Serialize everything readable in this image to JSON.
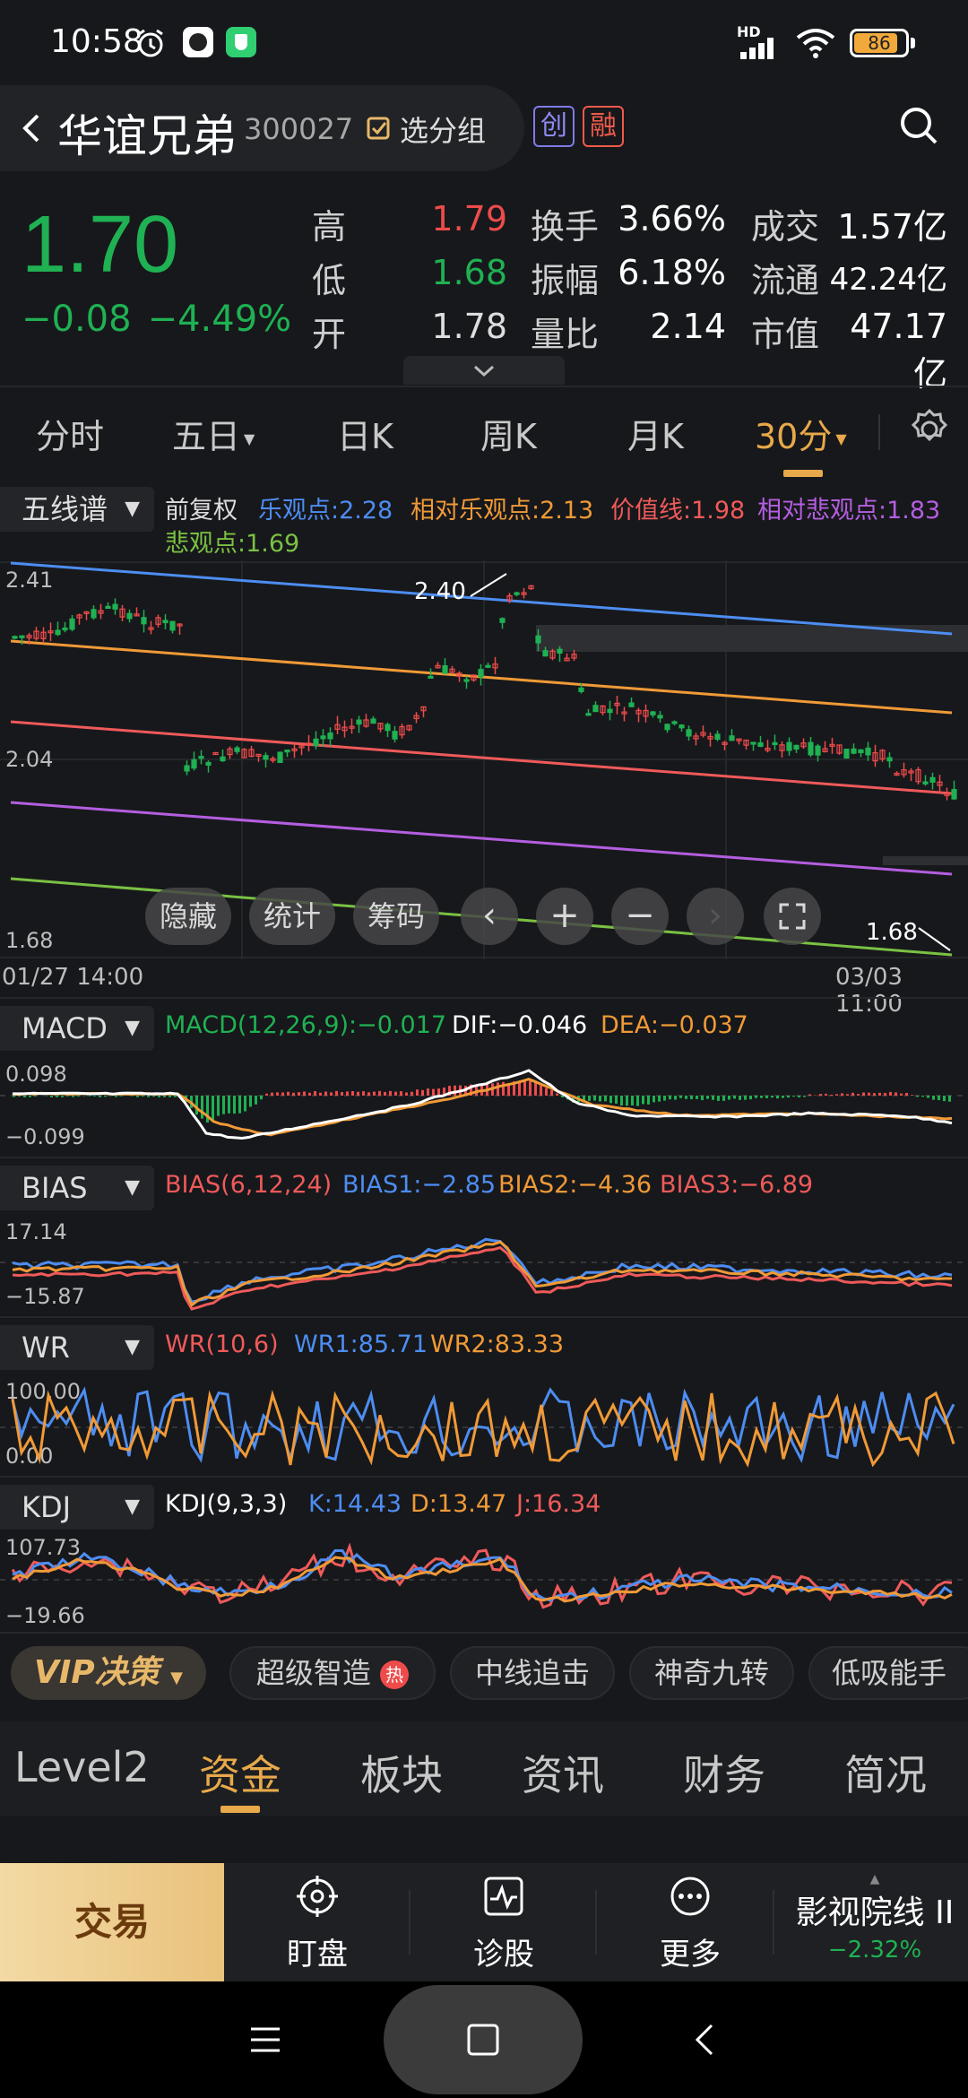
{
  "status_bar": {
    "time": "10:58",
    "network": "HD",
    "battery": "86",
    "icons": [
      "alarm-icon",
      "app-icon",
      "shield-app-icon",
      "signal-icon",
      "wifi-icon",
      "battery-icon"
    ]
  },
  "header": {
    "name": "华谊兄弟",
    "code": "300027",
    "group_label": "选分组",
    "tag_chuang": "创",
    "tag_rong": "融"
  },
  "quote": {
    "price": "1.70",
    "change": "−0.08",
    "change_pct": "−4.49%",
    "high_label": "高",
    "high": "1.79",
    "low_label": "低",
    "low": "1.68",
    "open_label": "开",
    "open": "1.78",
    "turnover_label": "换手",
    "turnover": "3.66%",
    "amplitude_label": "振幅",
    "amplitude": "6.18%",
    "volratio_label": "量比",
    "volratio": "2.14",
    "amount_label": "成交",
    "amount": "1.57亿",
    "float_label": "流通",
    "float": "42.24亿",
    "mcap_label": "市值",
    "mcap": "47.17亿"
  },
  "period_tabs": [
    "分时",
    "五日",
    "日K",
    "周K",
    "月K",
    "30分"
  ],
  "active_period": "30分",
  "main_chart": {
    "indicator": "五线谱",
    "adjust": "前复权",
    "legend": [
      {
        "label": "乐观点:2.28",
        "color": "#4d8df2"
      },
      {
        "label": "相对乐观点:2.13",
        "color": "#f09a37"
      },
      {
        "label": "价值线:1.98",
        "color": "#ef5a5a"
      },
      {
        "label": "相对悲观点:1.83",
        "color": "#b45ee0"
      },
      {
        "label": "悲观点:1.69",
        "color": "#7ac143"
      }
    ],
    "y_top": "2.41",
    "y_mid": "2.04",
    "y_bottom": "1.68",
    "high_marker": "2.40",
    "low_marker": "1.68",
    "time_start": "01/27 14:00",
    "time_end": "03/03 11:00",
    "buttons": [
      "隐藏",
      "统计",
      "筹码"
    ]
  },
  "macd": {
    "name": "MACD",
    "params": "MACD(12,26,9):−0.017",
    "dif": "DIF:−0.046",
    "dea": "DEA:−0.037",
    "y_top": "0.098",
    "y_bottom": "−0.099"
  },
  "bias": {
    "name": "BIAS",
    "params": "BIAS(6,12,24)",
    "b1": "BIAS1:−2.85",
    "b2": "BIAS2:−4.36",
    "b3": "BIAS3:−6.89",
    "y_top": "17.14",
    "y_bottom": "−15.87"
  },
  "wr": {
    "name": "WR",
    "params": "WR(10,6)",
    "w1": "WR1:85.71",
    "w2": "WR2:83.33",
    "y_top": "100.00",
    "y_bottom": "0.00"
  },
  "kdj": {
    "name": "KDJ",
    "params": "KDJ(9,3,3)",
    "k": "K:14.43",
    "d": "D:13.47",
    "j": "J:16.34",
    "y_top": "107.73",
    "y_bottom": "−19.66"
  },
  "strategy": {
    "vip": "VIP决策",
    "chips": [
      "超级智造",
      "中线追击",
      "神奇九转",
      "低吸能手"
    ],
    "hot_badge": "热"
  },
  "bottom_tabs": [
    "Level2",
    "资金",
    "板块",
    "资讯",
    "财务",
    "简况"
  ],
  "active_bottom_tab": "资金",
  "action_bar": {
    "trade": "交易",
    "watch": "盯盘",
    "diagnose": "诊股",
    "more": "更多",
    "sector_name": "影视院线 II",
    "sector_pct": "−2.32%"
  },
  "colors": {
    "up": "#ee4b4b",
    "down": "#1fb153",
    "accent": "#e8a94a",
    "bg": "#17181b"
  }
}
